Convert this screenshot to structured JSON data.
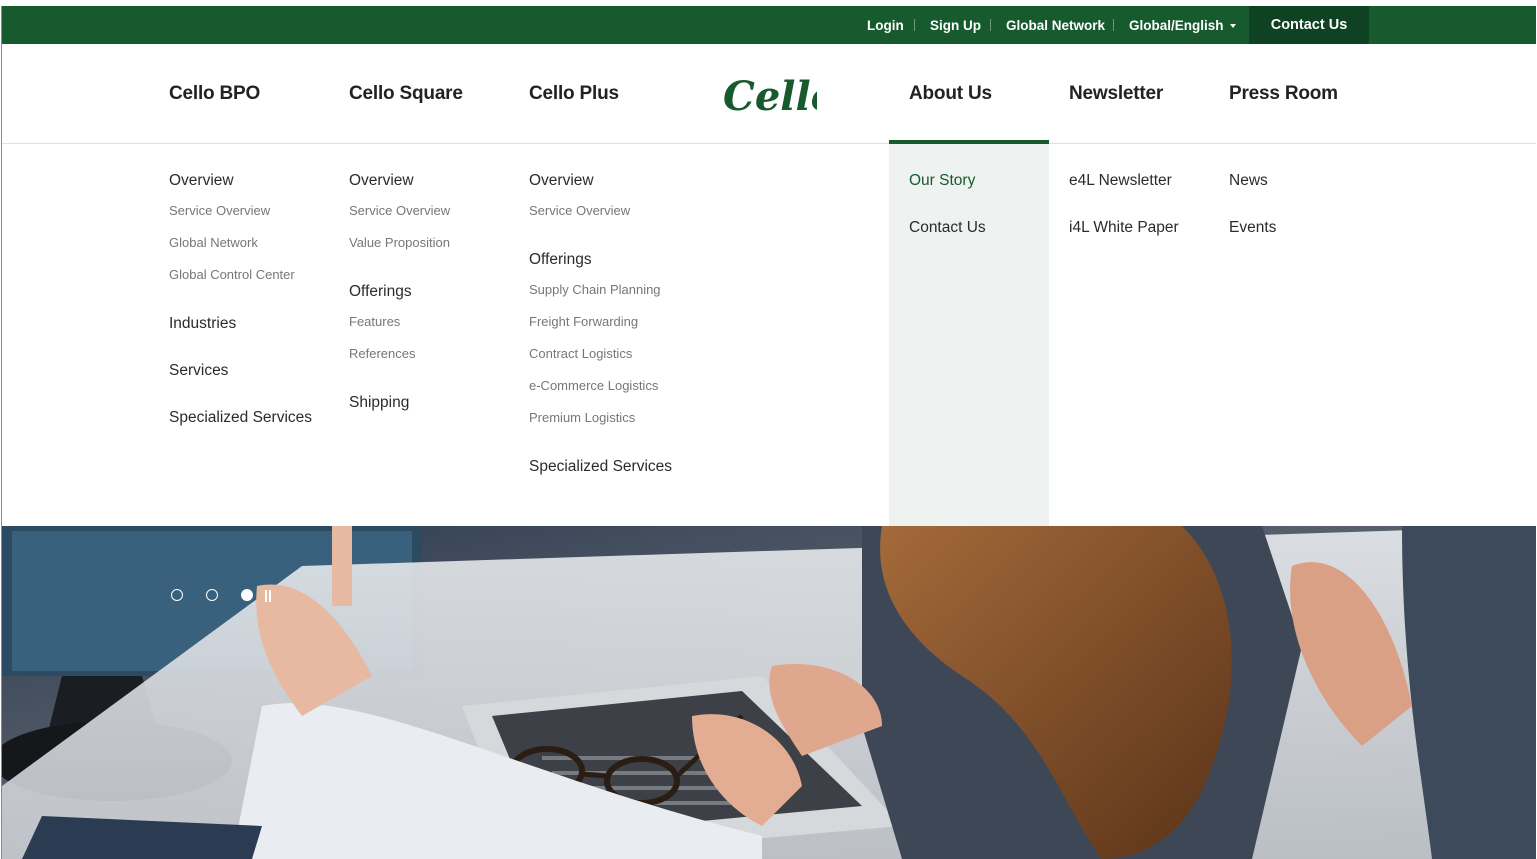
{
  "utility_nav": {
    "login": "Login",
    "signup": "Sign Up",
    "global_network": "Global Network",
    "language": "Global/English",
    "contact": "Contact Us"
  },
  "logo_text": "Cello",
  "main_nav": [
    "Cello BPO",
    "Cello Square",
    "Cello Plus",
    "About Us",
    "Newsletter",
    "Press Room"
  ],
  "active_nav": "About Us",
  "mega_menu": {
    "bpo": {
      "overview": "Overview",
      "overview_items": [
        "Service Overview",
        "Global Network",
        "Global Control Center"
      ],
      "industries": "Industries",
      "services": "Services",
      "specialized": "Specialized Services"
    },
    "square": {
      "overview": "Overview",
      "overview_items": [
        "Service Overview",
        "Value Proposition"
      ],
      "offerings": "Offerings",
      "offerings_items": [
        "Features",
        "References"
      ],
      "shipping": "Shipping"
    },
    "plus": {
      "overview": "Overview",
      "overview_items": [
        "Service Overview"
      ],
      "offerings": "Offerings",
      "offerings_items": [
        "Supply Chain Planning",
        "Freight Forwarding",
        "Contract Logistics",
        "e-Commerce Logistics",
        "Premium Logistics"
      ],
      "specialized": "Specialized Services"
    },
    "about": [
      "Our Story",
      "Contact Us"
    ],
    "newsletter": [
      "e4L Newsletter",
      "i4L White Paper"
    ],
    "press": [
      "News",
      "Events"
    ]
  },
  "slider": {
    "count": 3,
    "active": 3
  },
  "colors": {
    "brand_green": "#165a2e",
    "dark_green": "#0f4223",
    "panel_bg": "#eef2f0"
  }
}
